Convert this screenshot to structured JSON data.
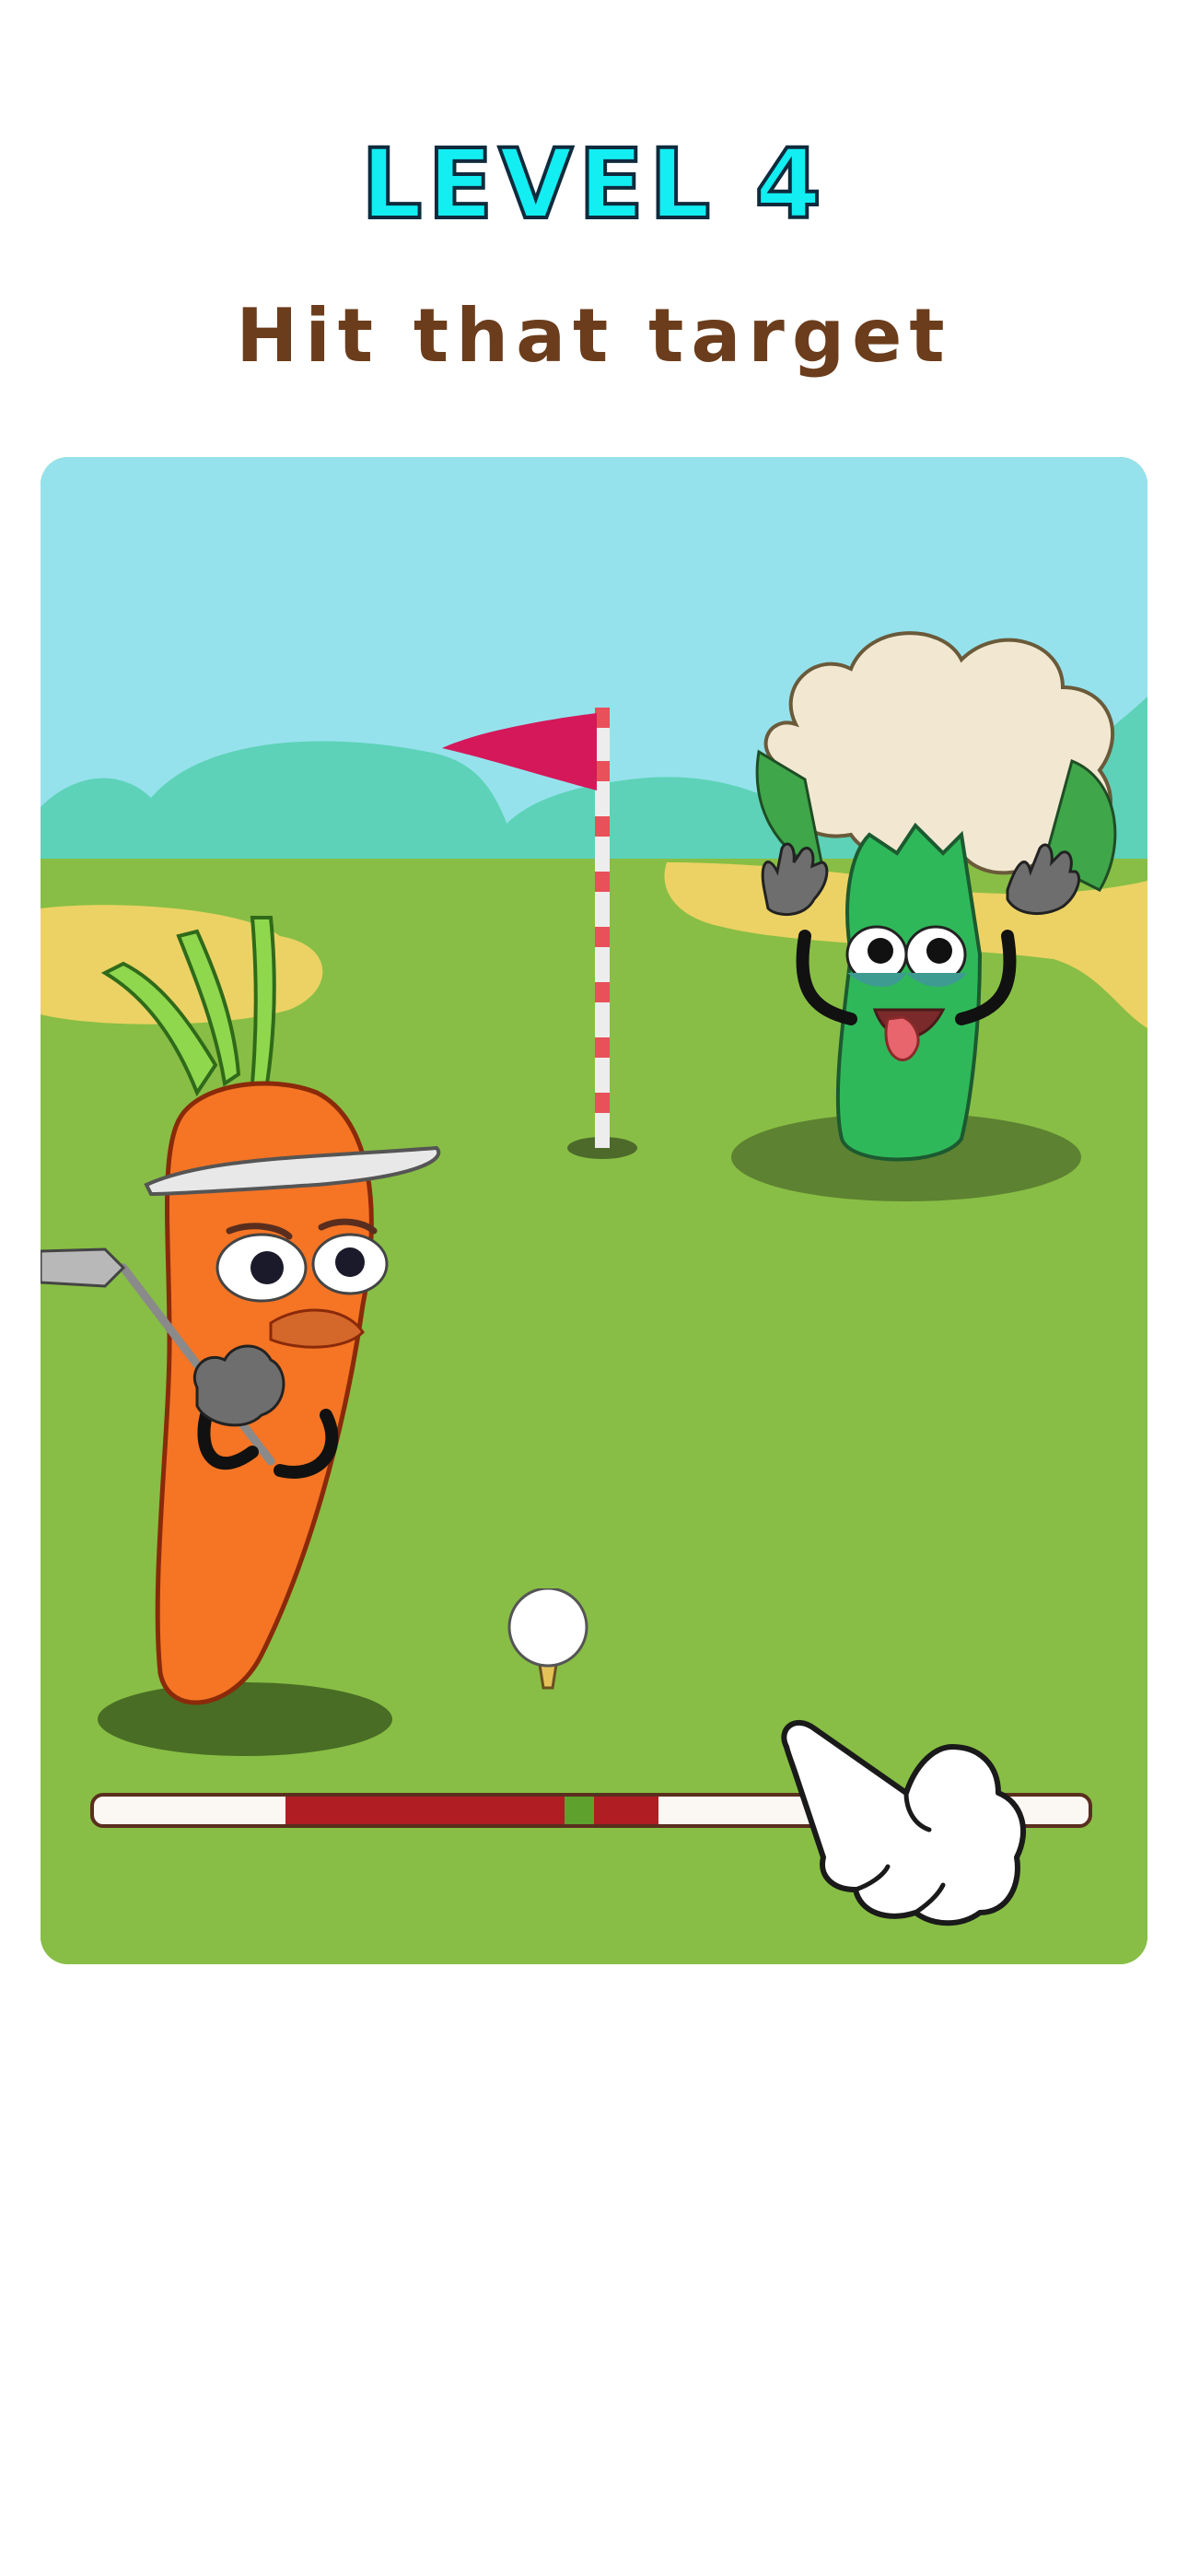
{
  "header": {
    "level_label": "LEVEL 4",
    "instruction": "Hit that target"
  },
  "game": {
    "power_meter": {
      "red_zone_start": 0.193,
      "red_zone_end": 0.568,
      "sweet_spot_start": 0.473,
      "sweet_spot_end": 0.503
    },
    "characters": [
      "carrot-golfer",
      "celery-cauliflower-target"
    ],
    "objects": [
      "golf-ball",
      "golf-tee",
      "flag-pole",
      "golf-hole",
      "tap-hint-hand"
    ]
  },
  "colors": {
    "level_text": "#12eef2",
    "instruction_text": "#6b3d1c",
    "sky": "#95e2ec",
    "grass": "#88be45",
    "hills": "#5dd2b8",
    "sand": "#ecd264",
    "flag": "#d4185a",
    "power_red": "#b01e24",
    "power_green": "#5ea12d"
  }
}
